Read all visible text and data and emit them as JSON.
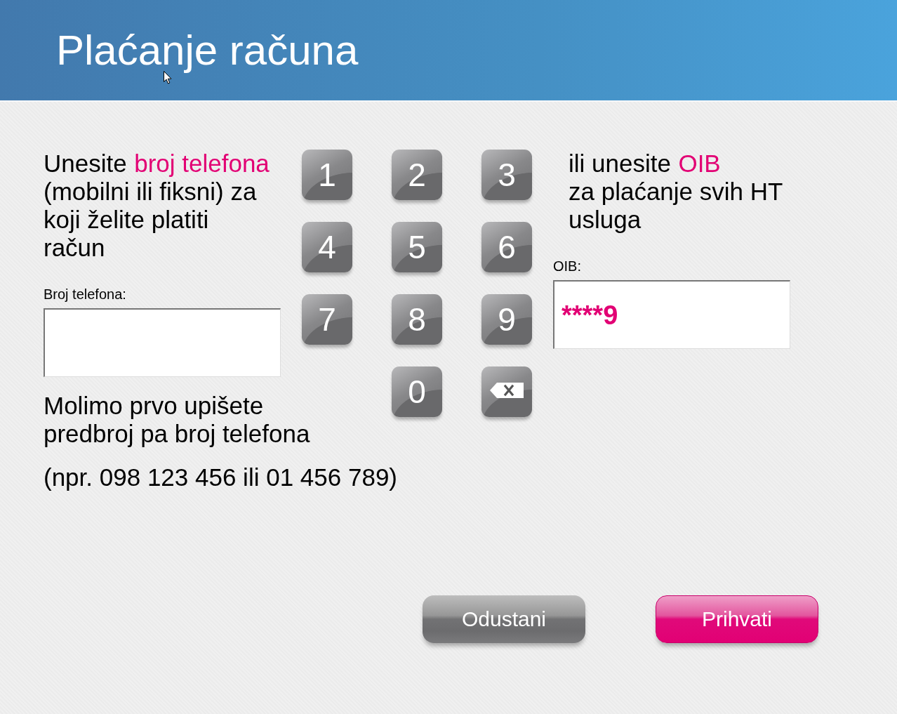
{
  "header": {
    "title": "Plaćanje računa"
  },
  "phone": {
    "prompt": [
      [
        {
          "text": "Unesite",
          "highlight": false
        },
        {
          "text": "broj telefona",
          "highlight": true
        }
      ],
      [
        {
          "text": "(mobilni ili fiksni) za",
          "highlight": false
        }
      ],
      [
        {
          "text": "koji želite platiti",
          "highlight": false
        }
      ],
      [
        {
          "text": "račun",
          "highlight": false
        }
      ]
    ],
    "label": "Broj telefona:",
    "hint": "Molimo prvo upišete predbroj pa broj telefona",
    "example": "(npr. 098 123 456 ili 01 456 789)"
  },
  "keypad": {
    "keys": [
      {
        "kind": "digit",
        "label": "1"
      },
      {
        "kind": "digit",
        "label": "2"
      },
      {
        "kind": "digit",
        "label": "3"
      },
      {
        "kind": "digit",
        "label": "4"
      },
      {
        "kind": "digit",
        "label": "5"
      },
      {
        "kind": "digit",
        "label": "6"
      },
      {
        "kind": "digit",
        "label": "7"
      },
      {
        "kind": "digit",
        "label": "8"
      },
      {
        "kind": "digit",
        "label": "9"
      },
      {
        "kind": "digit",
        "label": "0"
      },
      {
        "kind": "backspace"
      }
    ]
  },
  "oib": {
    "prompt": [
      [
        {
          "text": "ili unesite",
          "highlight": false
        },
        {
          "text": "OIB",
          "highlight": true
        }
      ],
      [
        {
          "text": "za plaćanje svih HT",
          "highlight": false
        }
      ],
      [
        {
          "text": "usluga",
          "highlight": false
        }
      ]
    ],
    "label": "OIB:",
    "value": "****9"
  },
  "buttons": [
    {
      "kind": "secondary",
      "label": "Odustani"
    },
    {
      "kind": "primary",
      "label": "Prihvati"
    }
  ]
}
